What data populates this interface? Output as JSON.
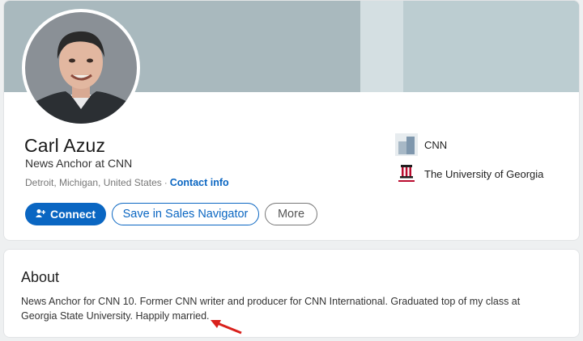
{
  "profile": {
    "name": "Carl Azuz",
    "headline": "News Anchor at CNN",
    "location": "Detroit, Michigan, United States",
    "separator": "·",
    "contact_info_label": "Contact info"
  },
  "actions": {
    "connect_label": "Connect",
    "sales_navigator_label": "Save in Sales Navigator",
    "more_label": "More"
  },
  "experience": [
    {
      "name": "CNN",
      "logo_icon": "company-logo-icon"
    },
    {
      "name": "The University of Georgia",
      "logo_icon": "university-seal-icon"
    }
  ],
  "about": {
    "title": "About",
    "text": "News Anchor for CNN 10. Former CNN writer and producer for CNN International. Graduated top of my class at Georgia State University. Happily married."
  },
  "colors": {
    "primary": "#0a66c2",
    "banner": "#a9b9be",
    "annotation_arrow": "#d9211c"
  }
}
